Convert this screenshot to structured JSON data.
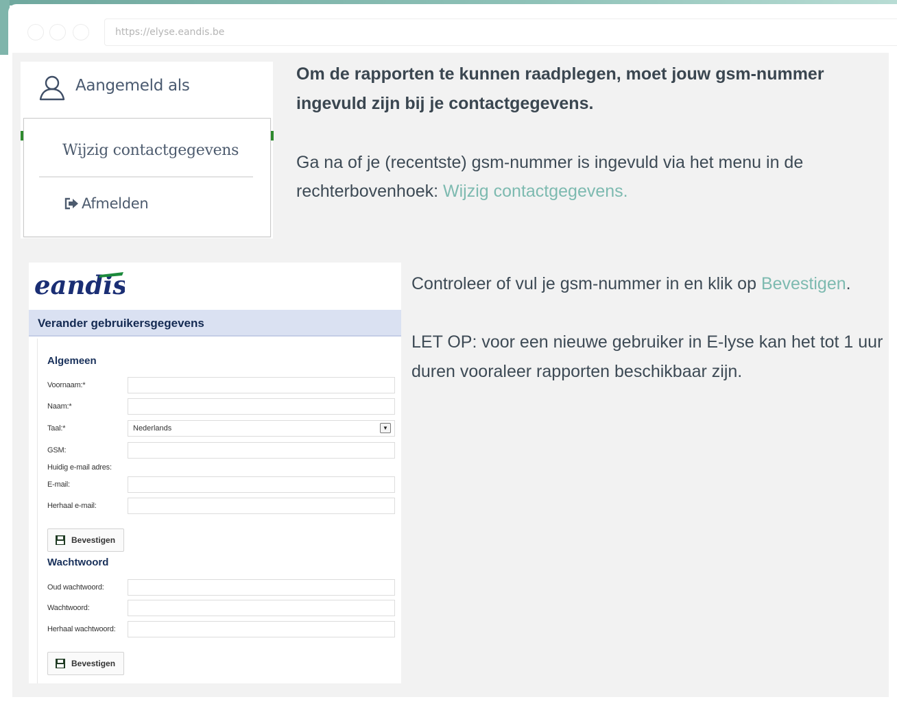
{
  "browser": {
    "url": "https://elyse.eandis.be"
  },
  "account_menu": {
    "signed_in_label": "Aangemeld als",
    "items": [
      {
        "label": "Wijzig contactgegevens"
      },
      {
        "label": "Afmelden"
      }
    ]
  },
  "instructions": {
    "intro_bold": "Om de rapporten te kunnen raadplegen, moet jouw gsm-nummer ingevuld zijn bij je contactgegevens.",
    "step1_text": "Ga na of je (recentste) gsm-nummer is ingevuld via het menu in de rechterbovenhoek: ",
    "step1_link": "Wijzig contactgegevens.",
    "step2_text": "Controleer of vul je gsm-nummer in en klik op ",
    "step2_link": "Bevestigen",
    "step2_end": ".",
    "note": "LET OP: voor een nieuwe gebruiker in E-lyse kan het tot 1 uur duren vooraleer rapporten beschikbaar zijn."
  },
  "form": {
    "logo_text": "eandis",
    "header": "Verander gebruikersgegevens",
    "section_general": "Algemeen",
    "fields_general": [
      {
        "label": "Voornaam:*",
        "value": ""
      },
      {
        "label": "Naam:*",
        "value": ""
      },
      {
        "label": "Taal:*",
        "value": "Nederlands"
      },
      {
        "label": "GSM:",
        "value": ""
      },
      {
        "label": "Huidig e-mail adres:",
        "value": ""
      },
      {
        "label": "E-mail:",
        "value": ""
      },
      {
        "label": "Herhaal e-mail:",
        "value": ""
      }
    ],
    "confirm_label": "Bevestigen",
    "section_password": "Wachtwoord",
    "fields_password": [
      {
        "label": "Oud wachtwoord:",
        "value": ""
      },
      {
        "label": "Wachtwoord:",
        "value": ""
      },
      {
        "label": "Herhaal wachtwoord:",
        "value": ""
      }
    ]
  },
  "colors": {
    "link": "#7dbab0",
    "form_header_bg": "#dae1f2",
    "form_title": "#18305a",
    "teal_frame": "#7fb5ab"
  }
}
